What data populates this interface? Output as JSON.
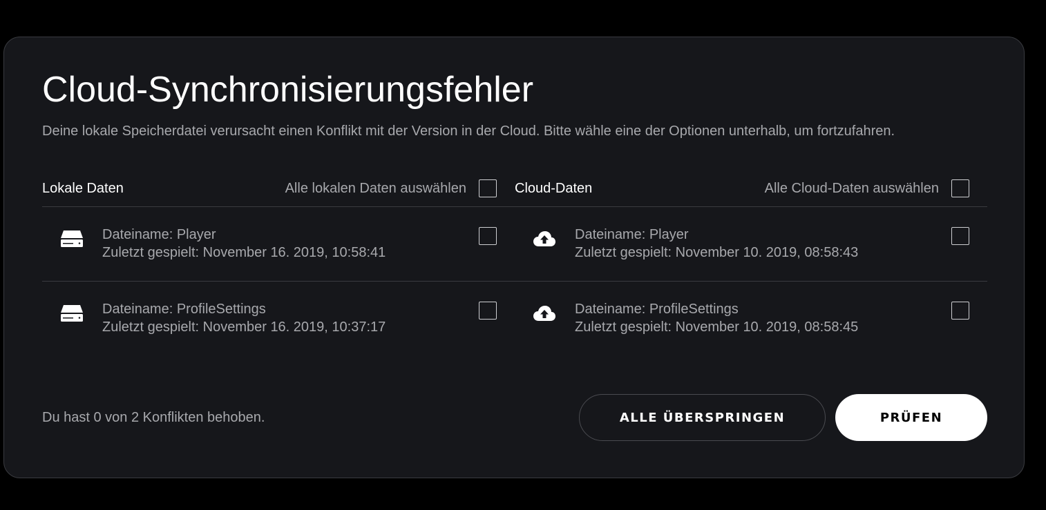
{
  "dialog": {
    "title": "Cloud-Synchronisierungsfehler",
    "subtitle": "Deine lokale Speicherdatei verursacht einen Konflikt mit der Version in der Cloud. Bitte wähle eine der Optionen unterhalb, um fortzufahren."
  },
  "local": {
    "header": "Lokale Daten",
    "select_all_label": "Alle lokalen Daten auswählen",
    "icon": "hard-drive-icon",
    "items": [
      {
        "filename": "Dateiname: Player",
        "last_played": "Zuletzt gespielt: November 16. 2019, 10:58:41"
      },
      {
        "filename": "Dateiname: ProfileSettings",
        "last_played": "Zuletzt gespielt: November 16. 2019, 10:37:17"
      }
    ]
  },
  "cloud": {
    "header": "Cloud-Daten",
    "select_all_label": "Alle Cloud-Daten auswählen",
    "icon": "cloud-upload-icon",
    "items": [
      {
        "filename": "Dateiname: Player",
        "last_played": "Zuletzt gespielt: November 10. 2019, 08:58:43"
      },
      {
        "filename": "Dateiname: ProfileSettings",
        "last_played": "Zuletzt gespielt: November 10. 2019, 08:58:45"
      }
    ]
  },
  "footer": {
    "status": "Du hast 0 von 2 Konflikten behoben.",
    "skip_all_label": "ALLE ÜBERSPRINGEN",
    "check_label": "PRÜFEN"
  },
  "colors": {
    "background": "#000000",
    "dialog_bg": "#16171b",
    "text_primary": "#ffffff",
    "text_secondary": "#a8a9ad",
    "divider": "#3a3b40",
    "primary_button_bg": "#ffffff"
  }
}
